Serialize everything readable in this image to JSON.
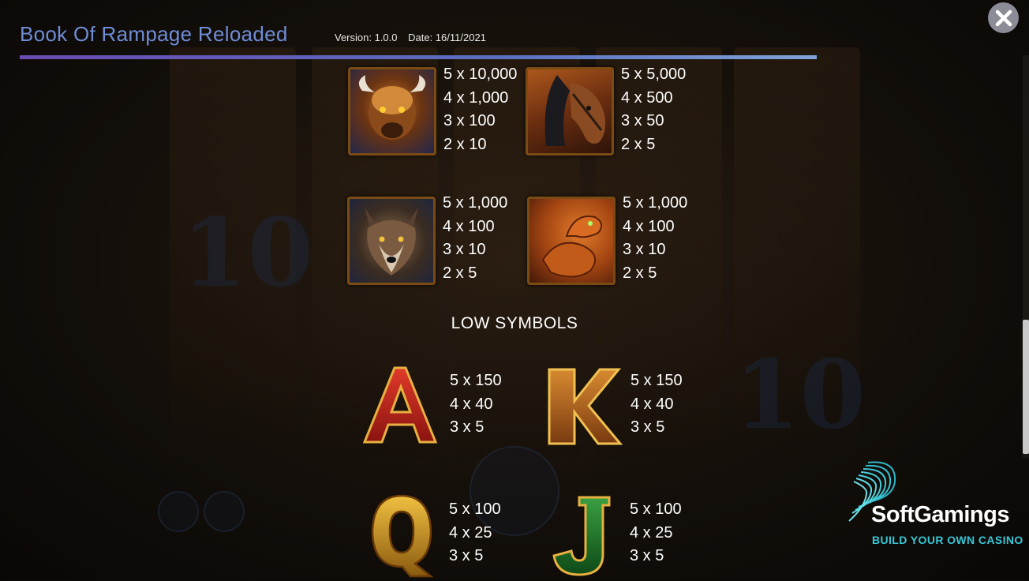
{
  "header": {
    "title": "Book Of Rampage Reloaded",
    "version": "Version: 1.0.0",
    "date": "Date: 16/11/2021"
  },
  "close_button": {
    "icon": "close-icon"
  },
  "high_symbols": [
    {
      "name": "bison",
      "payouts": [
        "5 x 10,000",
        "4 x 1,000",
        "3 x 100",
        "2 x 10"
      ]
    },
    {
      "name": "horse",
      "payouts": [
        "5 x 5,000",
        "4 x 500",
        "3 x 50",
        "2 x 5"
      ]
    },
    {
      "name": "wolf",
      "payouts": [
        "5 x 1,000",
        "4 x 100",
        "3 x 10",
        "2 x 5"
      ]
    },
    {
      "name": "snake",
      "payouts": [
        "5 x 1,000",
        "4 x 100",
        "3 x 10",
        "2 x 5"
      ]
    }
  ],
  "low_section_title": "LOW SYMBOLS",
  "low_symbols": [
    {
      "name": "A",
      "payouts": [
        "5 x 150",
        "4 x 40",
        "3 x 5"
      ]
    },
    {
      "name": "K",
      "payouts": [
        "5 x 150",
        "4 x 40",
        "3 x 5"
      ]
    },
    {
      "name": "Q",
      "payouts": [
        "5 x 100",
        "4 x 25",
        "3 x 5"
      ]
    },
    {
      "name": "J",
      "payouts": [
        "5 x 100",
        "4 x 25",
        "3 x 5"
      ]
    }
  ],
  "brand": {
    "name": "SoftGamings",
    "tagline": "BUILD YOUR OWN CASINO"
  },
  "colors": {
    "title": "#6f8cd6",
    "accent_line_start": "#6a4bb0",
    "accent_line_end": "#7fa3d8",
    "brand_teal": "#36c7d6",
    "frame_gold": "#7a4b14"
  }
}
